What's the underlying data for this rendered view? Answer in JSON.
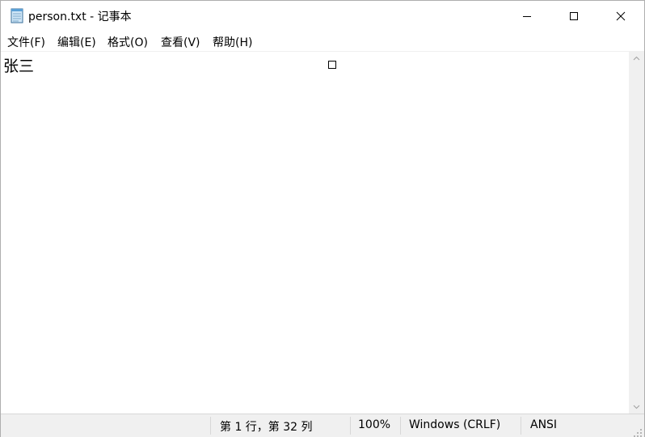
{
  "window": {
    "title": "person.txt - 记事本",
    "app_icon": "notepad-icon",
    "controls": {
      "minimize_icon": "minimize-icon",
      "maximize_icon": "maximize-icon",
      "close_icon": "close-icon"
    }
  },
  "menu": {
    "items": [
      {
        "label": "文件(F)"
      },
      {
        "label": "编辑(E)"
      },
      {
        "label": "格式(O)"
      },
      {
        "label": "查看(V)"
      },
      {
        "label": "帮助(H)"
      }
    ]
  },
  "editor": {
    "content": "张三"
  },
  "status": {
    "position": "第 1 行，第 32 列",
    "zoom": "100%",
    "line_ending": "Windows (CRLF)",
    "encoding": "ANSI"
  },
  "colors": {
    "background": "#ffffff",
    "chrome": "#f0f0f0",
    "border": "#d7d7d7"
  }
}
